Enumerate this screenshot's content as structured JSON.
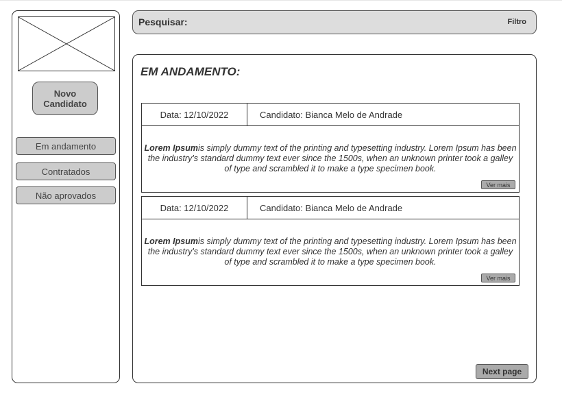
{
  "sidebar": {
    "new_candidate_label": "Novo Candidato",
    "nav": [
      {
        "label": "Em andamento"
      },
      {
        "label": "Contratados"
      },
      {
        "label": "Não aprovados"
      }
    ]
  },
  "search": {
    "label": "Pesquisar:",
    "value": "",
    "filter_label": "Filtro"
  },
  "main": {
    "title": "EM ANDAMENTO:",
    "cards": [
      {
        "date": "Data: 12/10/2022",
        "candidate": "Candidato: Bianca Melo de Andrade",
        "body_lead": "Lorem Ipsum",
        "body_text": "is simply dummy text of the printing and typesetting industry. Lorem Ipsum has been the industry's standard dummy text ever since the 1500s, when an unknown printer took a galley of type and scrambled it to make a type specimen book.",
        "more_label": "Ver mais"
      },
      {
        "date": "Data: 12/10/2022",
        "candidate": "Candidato: Bianca Melo de Andrade",
        "body_lead": "Lorem Ipsum",
        "body_text": "is simply dummy text of the printing and typesetting industry. Lorem Ipsum has been the industry's standard dummy text ever since the 1500s, when an unknown printer took a galley of type and scrambled it to make a type specimen book.",
        "more_label": "Ver mais"
      }
    ],
    "next_label": "Next page"
  }
}
